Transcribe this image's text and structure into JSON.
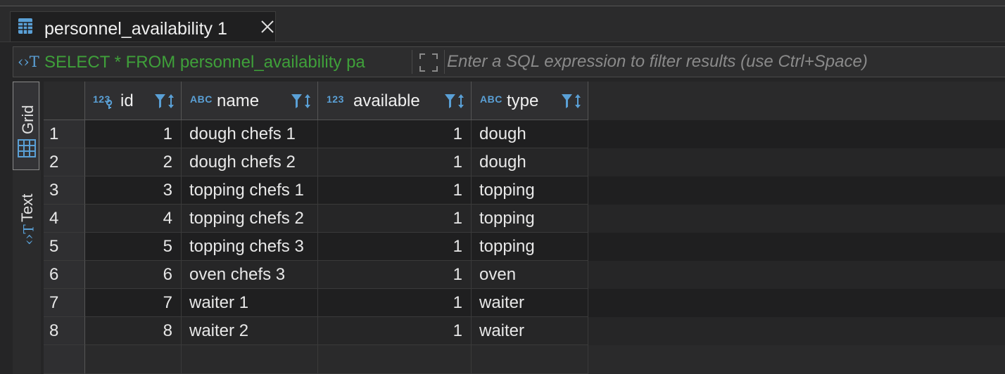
{
  "tab": {
    "title": "personnel_availability 1"
  },
  "filter": {
    "sql": "SELECT * FROM personnel_availability pa",
    "placeholder": "Enter a SQL expression to filter results (use Ctrl+Space)"
  },
  "sidebar": {
    "grid_label": "Grid",
    "text_label": "Text"
  },
  "columns": [
    {
      "type_label": "123",
      "name": "id"
    },
    {
      "type_label": "ABC",
      "name": "name"
    },
    {
      "type_label": "123",
      "name": "available"
    },
    {
      "type_label": "ABC",
      "name": "type"
    }
  ],
  "rows": [
    {
      "num": "1",
      "id": "1",
      "name": "dough chefs 1",
      "available": "1",
      "type": "dough"
    },
    {
      "num": "2",
      "id": "2",
      "name": "dough chefs 2",
      "available": "1",
      "type": "dough"
    },
    {
      "num": "3",
      "id": "3",
      "name": "topping chefs 1",
      "available": "1",
      "type": "topping"
    },
    {
      "num": "4",
      "id": "4",
      "name": "topping chefs 2",
      "available": "1",
      "type": "topping"
    },
    {
      "num": "5",
      "id": "5",
      "name": "topping chefs 3",
      "available": "1",
      "type": "topping"
    },
    {
      "num": "6",
      "id": "6",
      "name": "oven chefs 3",
      "available": "1",
      "type": "oven"
    },
    {
      "num": "7",
      "id": "7",
      "name": "waiter 1",
      "available": "1",
      "type": "waiter"
    },
    {
      "num": "8",
      "id": "8",
      "name": "waiter 2",
      "available": "1",
      "type": "waiter"
    }
  ],
  "colors": {
    "accent": "#5aa0d6",
    "sql_text": "#3fa03a",
    "background": "#252526"
  },
  "icons": {
    "tab": "table-icon",
    "close": "close-icon",
    "sql": "sql-icon",
    "expand": "expand-icon",
    "grid": "grid-icon",
    "text": "text-icon",
    "filter": "filter-sort-icon",
    "key": "key-icon"
  }
}
